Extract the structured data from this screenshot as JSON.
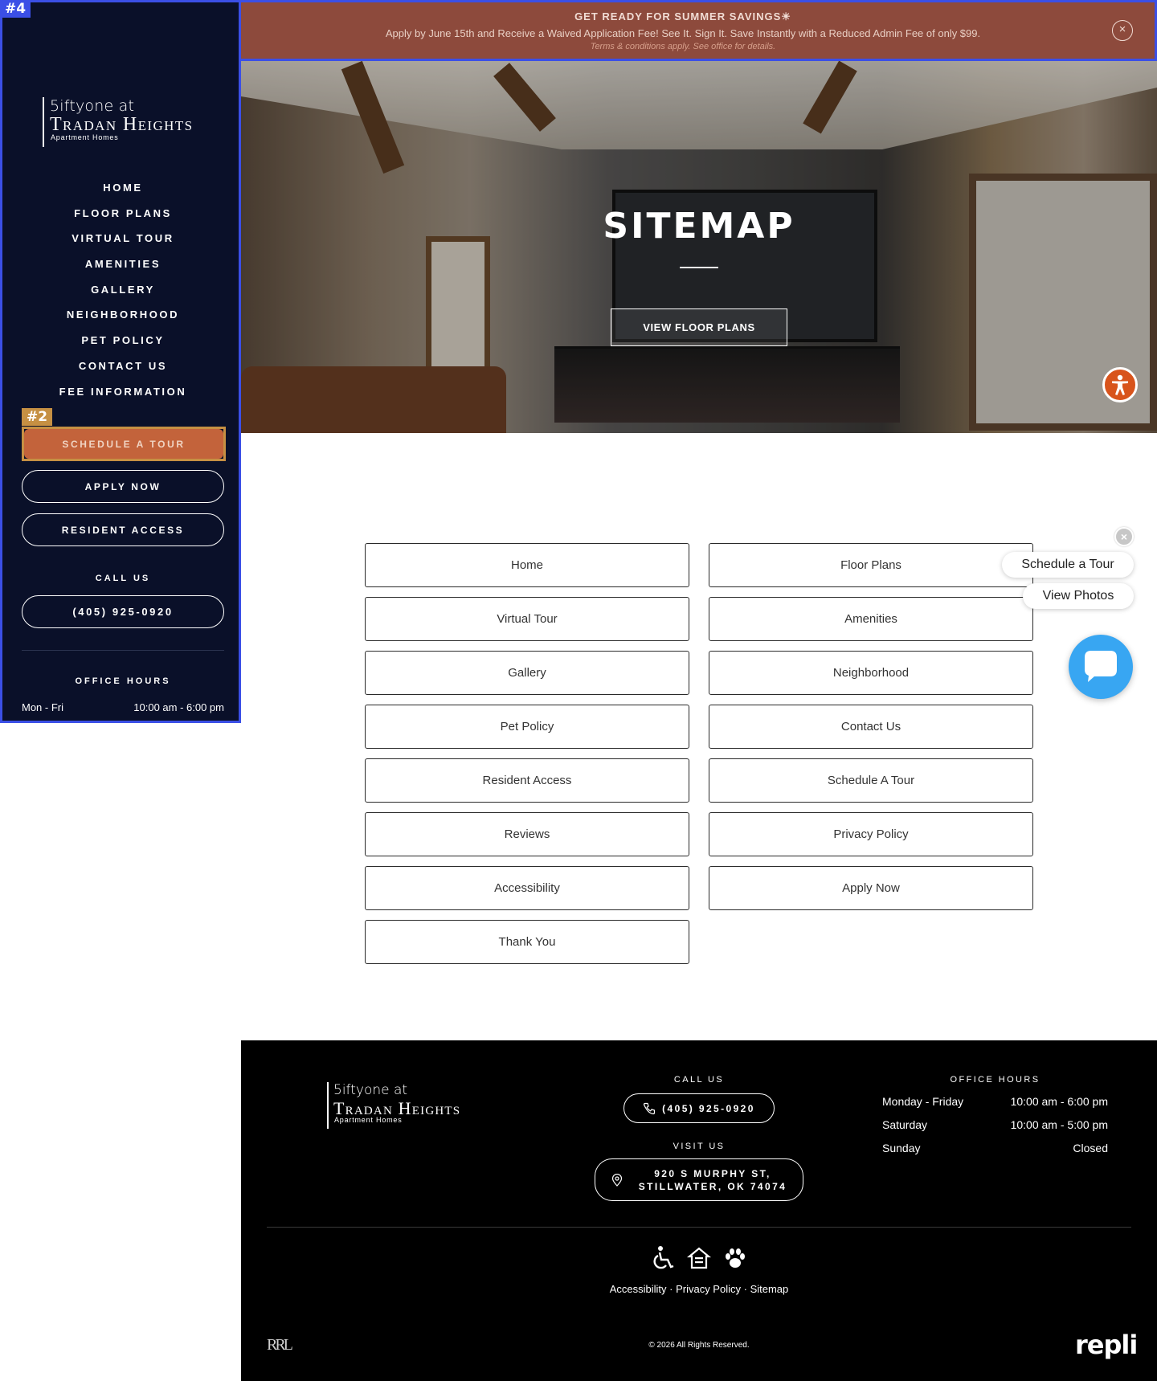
{
  "banner": {
    "title": "GET READY FOR SUMMER SAVINGS☀",
    "text": "Apply by June 15th and Receive a Waived Application Fee! See It. Sign It. Save Instantly with a Reduced Admin Fee of only $99.",
    "terms": "Terms & conditions apply. See office for details.",
    "close": "×"
  },
  "annotations": {
    "badge_4": "#4",
    "badge_2": "#2"
  },
  "logo": {
    "line1": "5iftyone at",
    "line2": "Tradan Heights",
    "line3": "Apartment Homes"
  },
  "nav": {
    "items": [
      {
        "label": "HOME"
      },
      {
        "label": "FLOOR PLANS"
      },
      {
        "label": "VIRTUAL TOUR"
      },
      {
        "label": "AMENITIES"
      },
      {
        "label": "GALLERY"
      },
      {
        "label": "NEIGHBORHOOD"
      },
      {
        "label": "PET POLICY"
      },
      {
        "label": "CONTACT US"
      },
      {
        "label": "FEE INFORMATION"
      }
    ]
  },
  "sidebar": {
    "schedule_tour": "SCHEDULE A TOUR",
    "apply_now": "APPLY NOW",
    "resident_access": "RESIDENT ACCESS",
    "call_us_label": "CALL US",
    "phone": "(405) 925-0920",
    "office_hours_label": "OFFICE HOURS",
    "hours_days": "Mon - Fri",
    "hours_time": "10:00 am - 6:00 pm"
  },
  "hero": {
    "title": "SITEMAP",
    "button": "VIEW FLOOR PLANS"
  },
  "sitemap": {
    "links": [
      "Home",
      "Floor Plans",
      "Virtual Tour",
      "Amenities",
      "Gallery",
      "Neighborhood",
      "Pet Policy",
      "Contact Us",
      "Resident Access",
      "Schedule A Tour",
      "Reviews",
      "Privacy Policy",
      "Accessibility",
      "Apply Now",
      "Thank You"
    ]
  },
  "chat": {
    "close": "×",
    "schedule": "Schedule a Tour",
    "photos": "View Photos"
  },
  "footer": {
    "call_label": "CALL US",
    "phone": "(405) 925-0920",
    "visit_label": "VISIT US",
    "address_line1": "920 S MURPHY ST,",
    "address_line2": "STILLWATER, OK 74074",
    "hours_label": "OFFICE HOURS",
    "hours": [
      {
        "day": "Monday - Friday",
        "time": "10:00 am - 6:00 pm"
      },
      {
        "day": "Saturday",
        "time": "10:00 am - 5:00 pm"
      },
      {
        "day": "Sunday",
        "time": "Closed"
      }
    ],
    "links": [
      "Accessibility",
      "Privacy Policy",
      "Sitemap"
    ],
    "separator": " · ",
    "copyright": "© 2026 All Rights Reserved.",
    "rrl": "RRL",
    "repli": "repli"
  },
  "colors": {
    "sidebar_bg": "#0a1029",
    "banner_bg": "#8d4a3c",
    "tour_button": "#c3633b",
    "annotation_outline": "#3b4fe6",
    "annotation_tag": "#c69043",
    "chat_bubble": "#38a6f2",
    "accessibility_button": "#d8541c"
  },
  "icons": {
    "banner_close": "close-icon",
    "footer_phone": "phone-icon",
    "footer_address": "map-pin-icon",
    "footer_accessibility": "wheelchair-icon",
    "footer_equal_housing": "equal-housing-icon",
    "footer_pet": "paw-icon",
    "hero_accessibility": "accessibility-icon",
    "chat": "chat-bubble-icon"
  }
}
